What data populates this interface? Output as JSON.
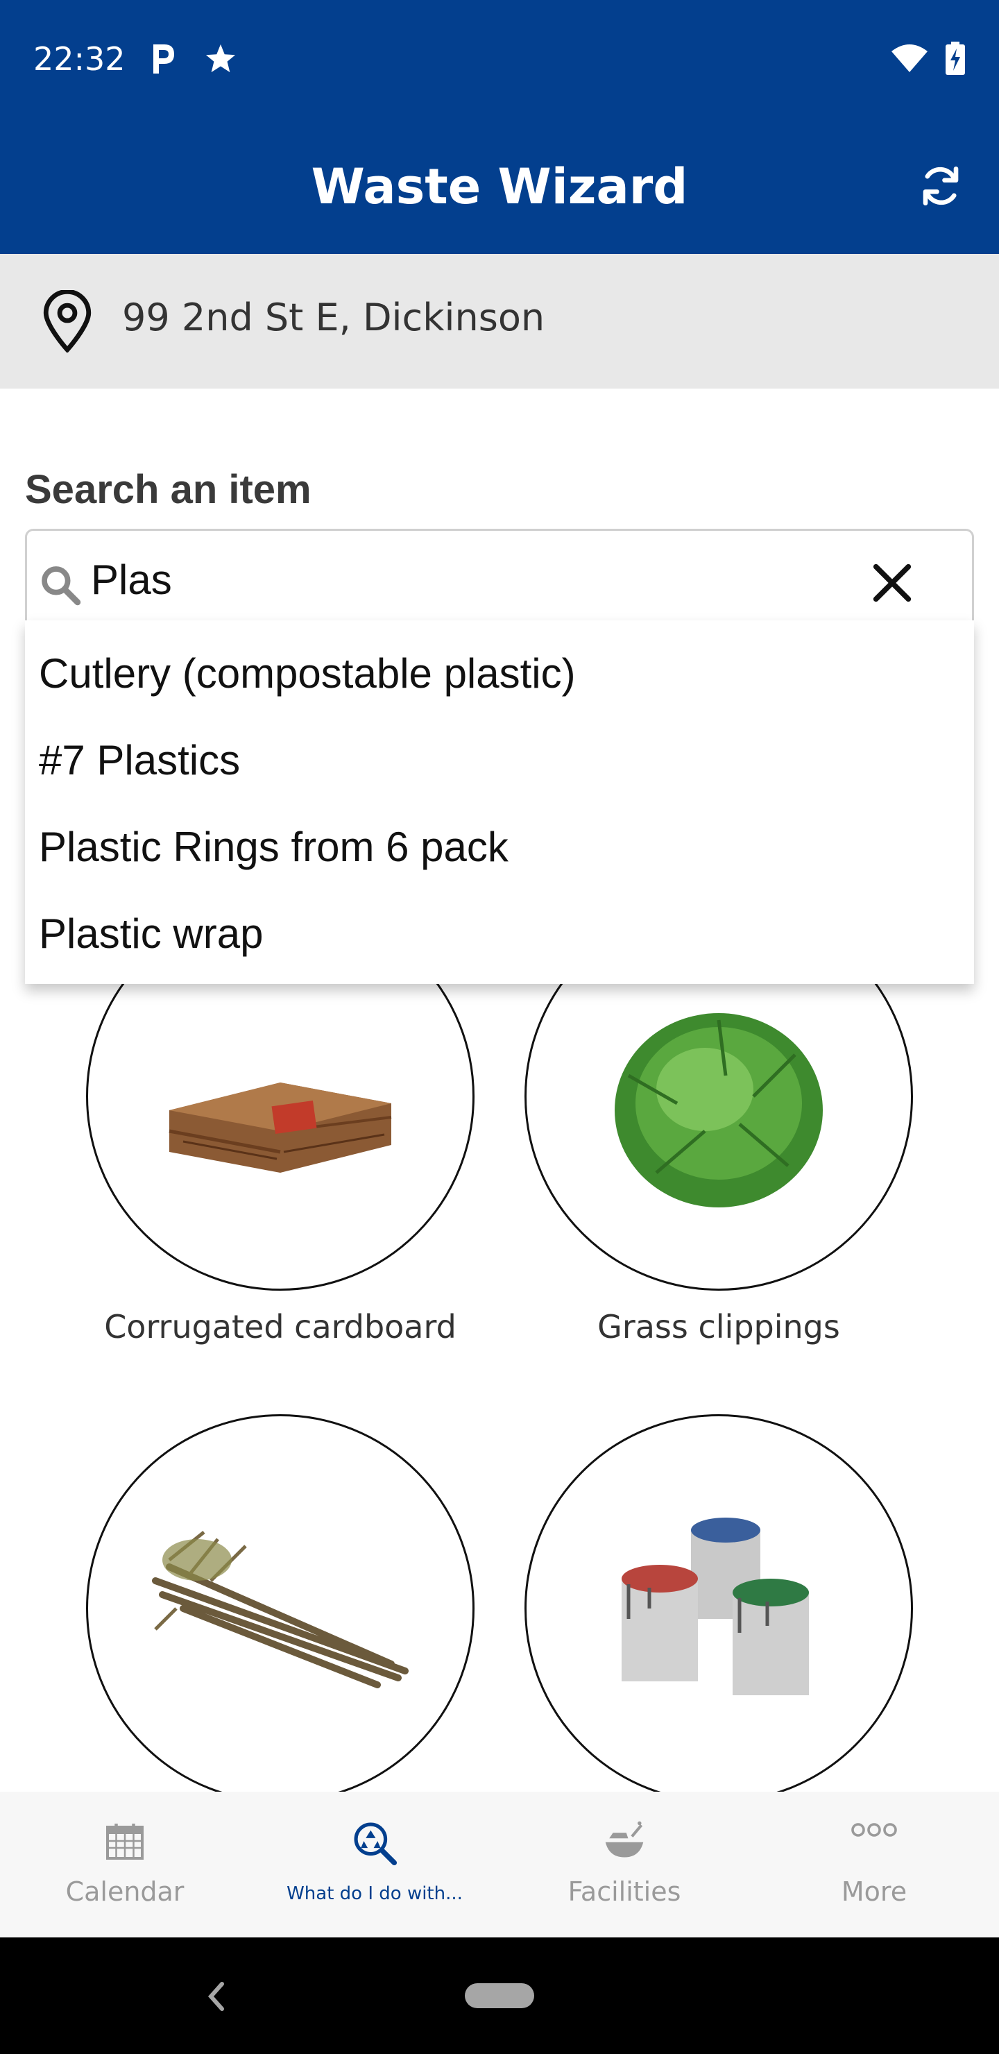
{
  "status_bar": {
    "time": "22:32",
    "left_icons": [
      "parking-icon",
      "star-icon"
    ],
    "right_icons": [
      "wifi-icon",
      "battery-charging-icon"
    ]
  },
  "app_bar": {
    "title": "Waste Wizard",
    "refresh_icon": "refresh-icon"
  },
  "address": {
    "icon": "location-pin-icon",
    "text": "99 2nd St E, Dickinson"
  },
  "search": {
    "label": "Search an item",
    "value": "Plas",
    "search_icon": "search-icon",
    "clear_icon": "close-icon"
  },
  "suggestions": [
    "Cutlery (compostable plastic)",
    "#7 Plastics",
    "Plastic Rings from 6 pack",
    "Plastic wrap"
  ],
  "items": [
    {
      "label": "Corrugated cardboard",
      "image": "cardboard-image"
    },
    {
      "label": "Grass clippings",
      "image": "grass-image"
    },
    {
      "label": "",
      "image": "branches-image"
    },
    {
      "label": "",
      "image": "paint-cans-image"
    }
  ],
  "bottom_nav": [
    {
      "label": "Calendar",
      "icon": "calendar-icon",
      "active": false
    },
    {
      "label": "What do I do with...",
      "icon": "recycle-search-icon",
      "active": true
    },
    {
      "label": "Facilities",
      "icon": "facilities-icon",
      "active": false
    },
    {
      "label": "More",
      "icon": "more-icon",
      "active": false
    }
  ],
  "colors": {
    "primary": "#033f8e",
    "address_bg": "#e8e8e8",
    "inactive_nav": "#9a9a9a"
  }
}
